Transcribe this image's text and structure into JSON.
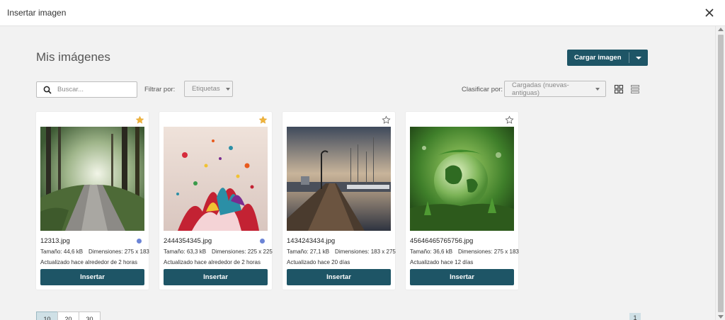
{
  "window": {
    "title": "Insertar imagen",
    "close_icon": "close-icon"
  },
  "header": {
    "title": "Mis imágenes"
  },
  "upload": {
    "label": "Cargar imagen",
    "menu_icon": "chevron-down-icon"
  },
  "toolbar": {
    "search_placeholder": "Buscar...",
    "filter_label": "Filtrar por:",
    "filter_value": "Etiquetas",
    "sort_label": "Clasificar por:",
    "sort_value": "Cargadas (nuevas-antiguas)",
    "views": [
      "grid-view-icon",
      "list-view-icon"
    ]
  },
  "images": [
    {
      "name": "12313.jpg",
      "starred": true,
      "status_dot": true,
      "size": "Tamaño: 44,6 kB",
      "dimensions": "Dimensiones: 275 x 183",
      "updated": "Actualizado hace alrededor de 2 horas",
      "insert_label": "Insertar"
    },
    {
      "name": "2444354345.jpg",
      "starred": true,
      "status_dot": true,
      "size": "Tamaño: 63,3 kB",
      "dimensions": "Dimensiones: 225 x 225",
      "updated": "Actualizado hace alrededor de 2 horas",
      "insert_label": "Insertar"
    },
    {
      "name": "1434243434.jpg",
      "starred": false,
      "status_dot": false,
      "size": "Tamaño: 27,1 kB",
      "dimensions": "Dimensiones: 183 x 275",
      "updated": "Actualizado hace 20 días",
      "insert_label": "Insertar"
    },
    {
      "name": "45646465765756.jpg",
      "starred": false,
      "status_dot": false,
      "size": "Tamaño: 36,6 kB",
      "dimensions": "Dimensiones: 275 x 183",
      "updated": "Actualizado hace 12 días",
      "insert_label": "Insertar"
    }
  ],
  "pagination": {
    "per_page": [
      "10",
      "20",
      "30"
    ],
    "active_per_page": "10",
    "current_page": "1"
  },
  "colors": {
    "primary": "#1e5566",
    "star_on": "#f0b43c",
    "status_dot": "#6b84d6"
  }
}
